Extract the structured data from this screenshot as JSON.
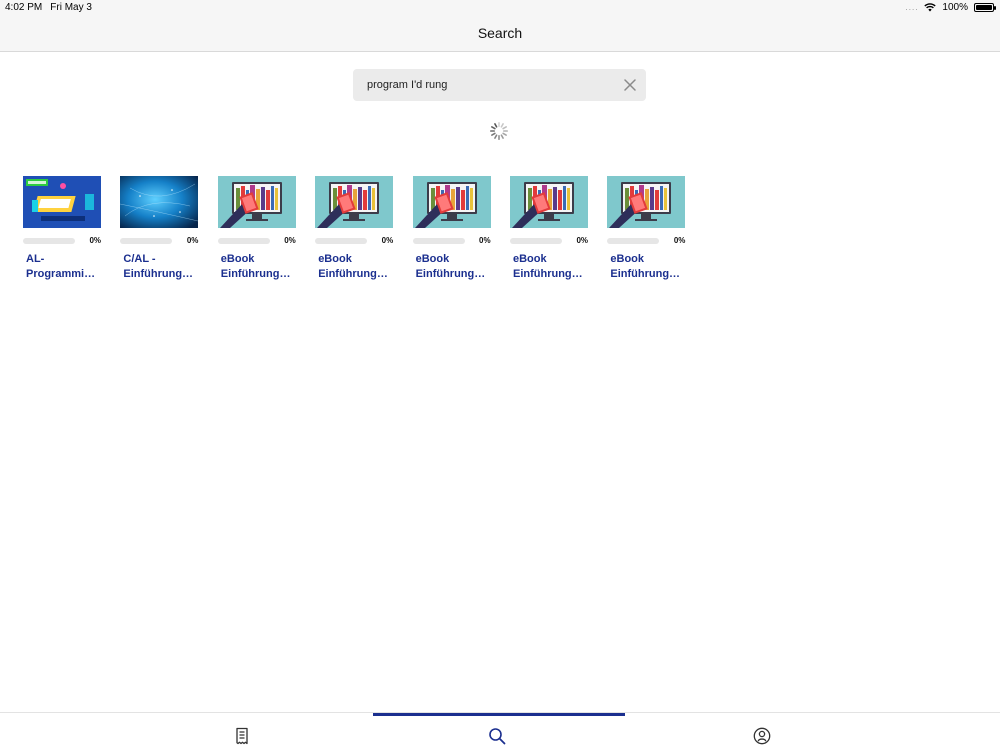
{
  "status": {
    "time": "4:02 PM",
    "date": "Fri May 3",
    "signal_dots": "....",
    "battery_text": "100%",
    "battery_level": 1.0
  },
  "nav": {
    "title": "Search"
  },
  "search": {
    "value": "program I'd rung",
    "placeholder": ""
  },
  "results": [
    {
      "title": "AL-Programmi…",
      "progress_text": "0%",
      "progress": 0,
      "thumbnail": "bestseller-programming-cover"
    },
    {
      "title": "C/AL - Einführung…",
      "progress_text": "0%",
      "progress": 0,
      "thumbnail": "blue-network-cover"
    },
    {
      "title": "eBook Einführung…",
      "progress_text": "0%",
      "progress": 0,
      "thumbnail": "ebook-monitor-cover"
    },
    {
      "title": "eBook Einführung…",
      "progress_text": "0%",
      "progress": 0,
      "thumbnail": "ebook-monitor-cover"
    },
    {
      "title": "eBook Einführung…",
      "progress_text": "0%",
      "progress": 0,
      "thumbnail": "ebook-monitor-cover"
    },
    {
      "title": "eBook Einführung…",
      "progress_text": "0%",
      "progress": 0,
      "thumbnail": "ebook-monitor-cover"
    },
    {
      "title": "eBook Einführung…",
      "progress_text": "0%",
      "progress": 0,
      "thumbnail": "ebook-monitor-cover"
    }
  ],
  "tabs": [
    {
      "icon": "receipt-icon",
      "active": false
    },
    {
      "icon": "search-icon",
      "active": true
    },
    {
      "icon": "profile-icon",
      "active": false
    }
  ],
  "colors": {
    "accent": "#1b2f8f",
    "ebook_bg": "#7fc8cc",
    "bestseller_bg": "#1f4fb5",
    "network_bg": "#1580c8"
  }
}
